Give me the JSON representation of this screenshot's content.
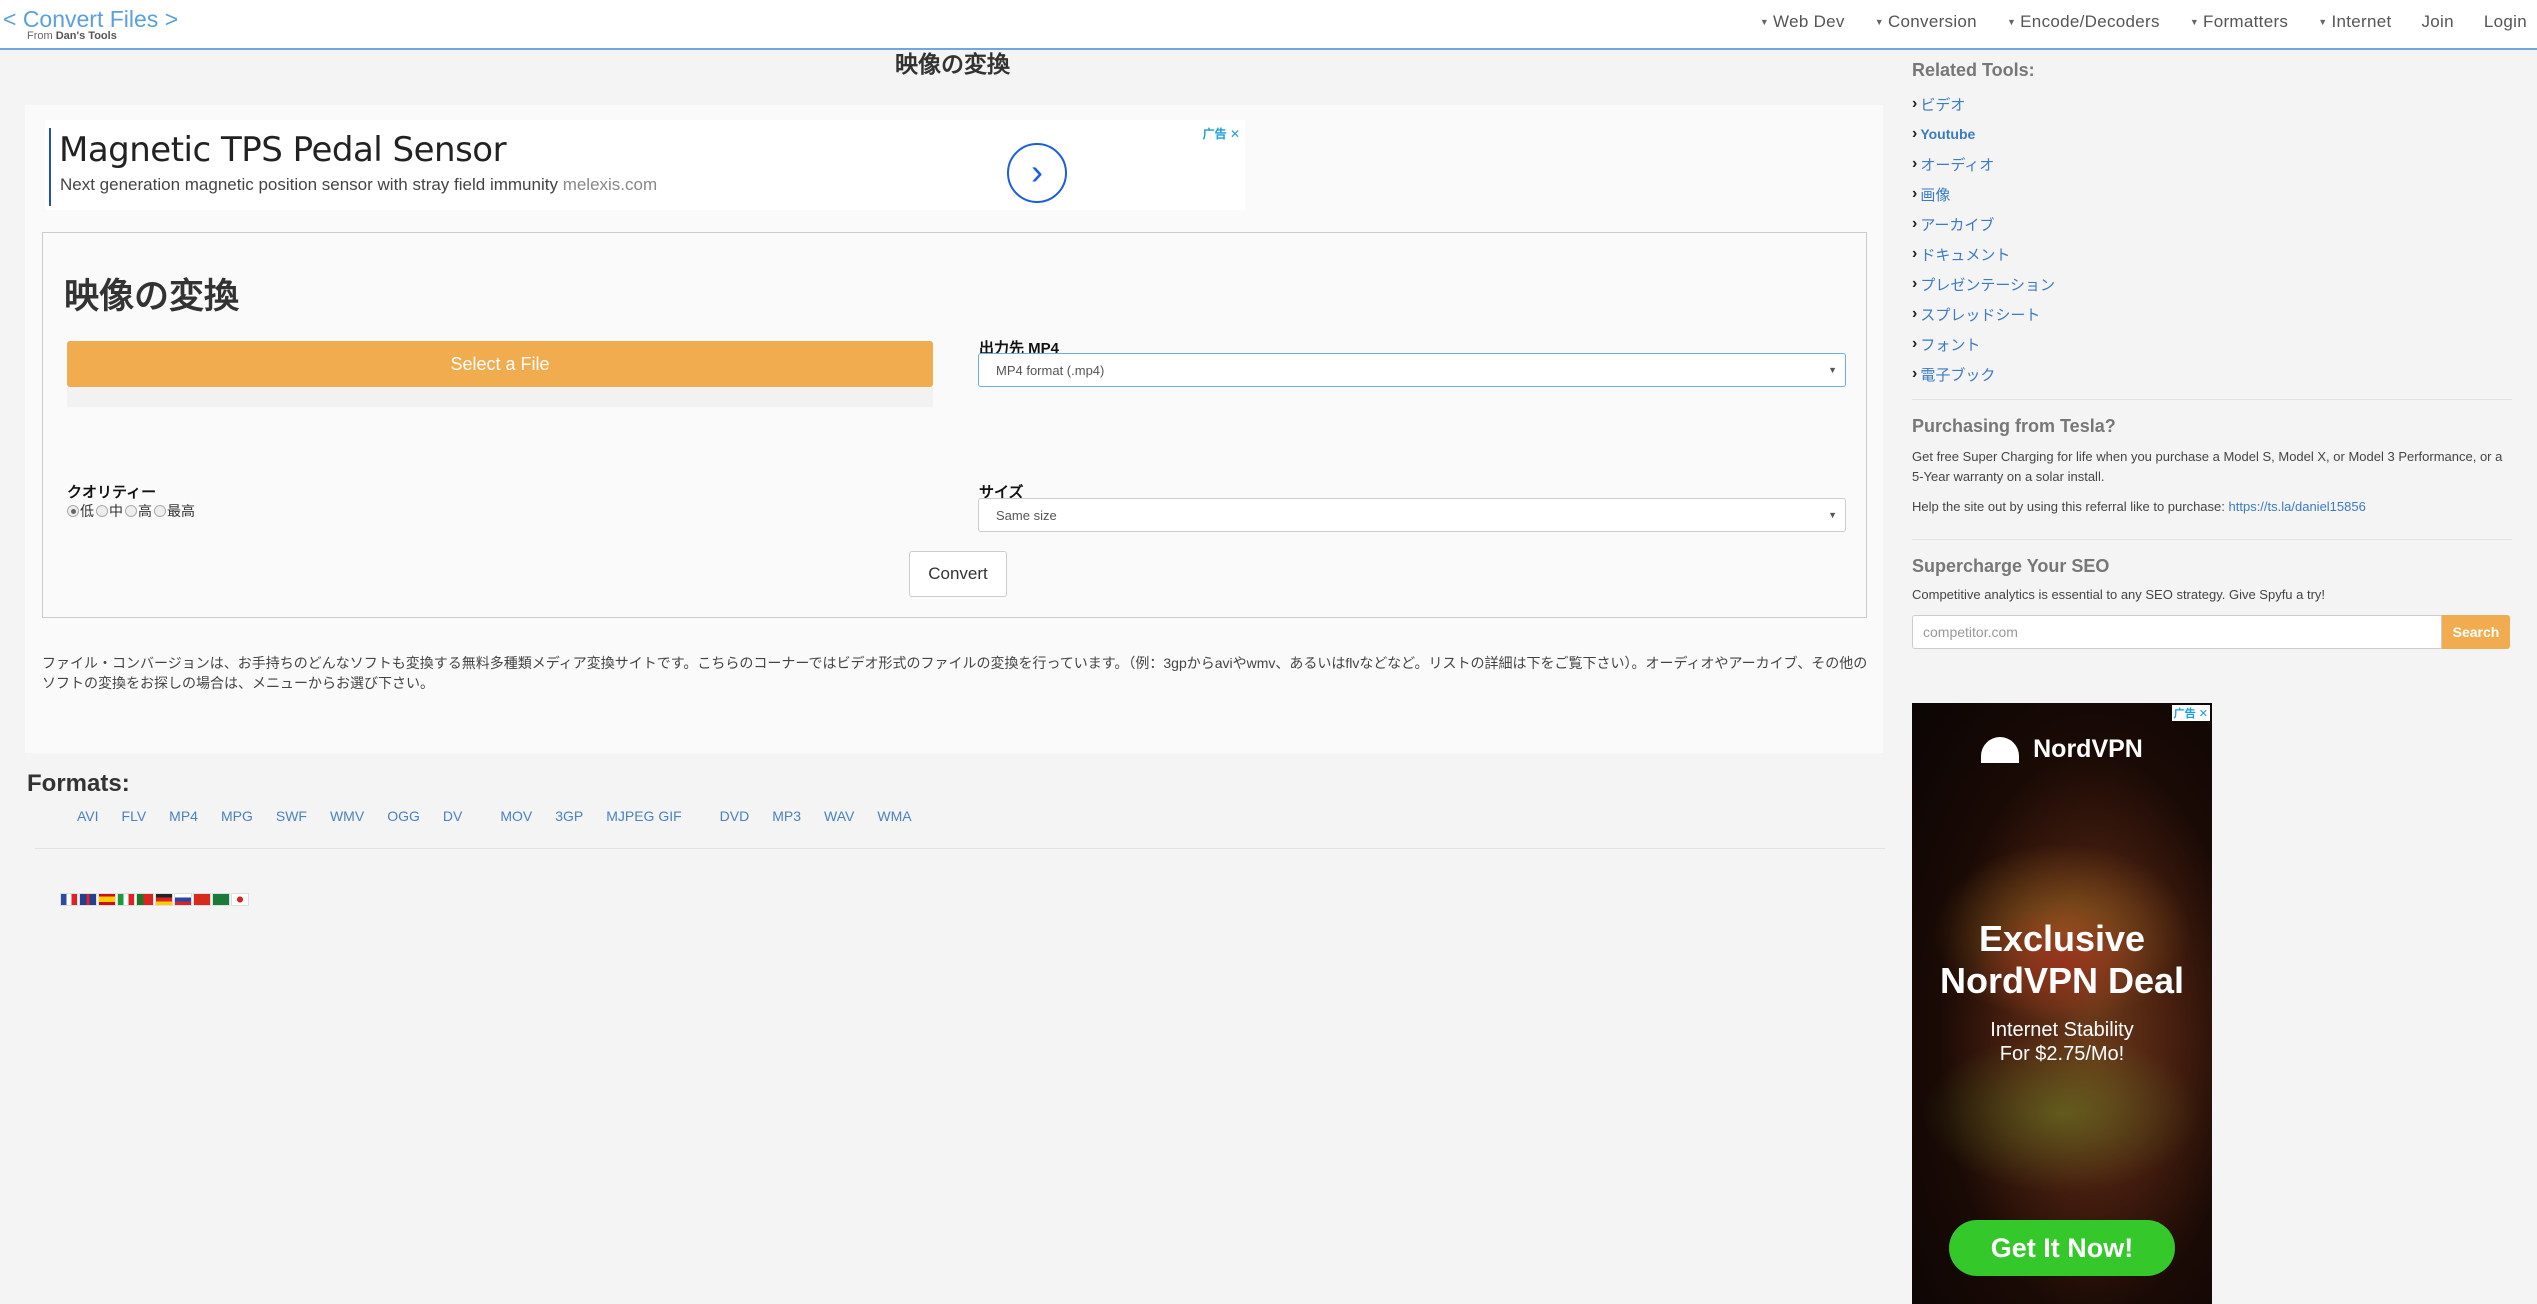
{
  "header": {
    "brand_title": "< Convert Files >",
    "brand_from": "From",
    "brand_owner": "Dan's Tools",
    "nav": [
      {
        "label": "Web Dev",
        "dropdown": true
      },
      {
        "label": "Conversion",
        "dropdown": true
      },
      {
        "label": "Encode/Decoders",
        "dropdown": true
      },
      {
        "label": "Formatters",
        "dropdown": true
      },
      {
        "label": "Internet",
        "dropdown": true
      },
      {
        "label": "Join",
        "dropdown": false
      },
      {
        "label": "Login",
        "dropdown": false
      }
    ]
  },
  "page_title": "映像の変換",
  "top_ad": {
    "headline": "Magnetic TPS Pedal Sensor",
    "description": "Next generation magnetic position sensor with stray field immunity",
    "domain": "melexis.com",
    "badge": "广告 ✕"
  },
  "form": {
    "title": "映像の変換",
    "select_file_label": "Select a File",
    "output_label": "出力先 MP4",
    "output_value": "MP4 format (.mp4)",
    "quality_label": "クオリティー",
    "quality_options": [
      {
        "label": "低",
        "checked": true
      },
      {
        "label": "中",
        "checked": false
      },
      {
        "label": "高",
        "checked": false
      },
      {
        "label": "最高",
        "checked": false
      }
    ],
    "size_label": "サイズ",
    "size_value": "Same size",
    "convert_label": "Convert"
  },
  "description": "ファイル・コンバージョンは、お手持ちのどんなソフトも変換する無料多種類メディア変換サイトです。こちらのコーナーではビデオ形式のファイルの変換を行っています。（例：3gpからaviやwmv、あるいはflvなどなど。リストの詳細は下をご覧下さい）。オーディオやアーカイブ、その他のソフトの変換をお探しの場合は、メニューからお選び下さい。",
  "formats": {
    "title": "Formats:",
    "items": [
      "AVI",
      "FLV",
      "MP4",
      "MPG",
      "SWF",
      "WMV",
      "OGG",
      "DV",
      "MOV",
      "3GP",
      "MJPEG GIF",
      "DVD",
      "MP3",
      "WAV",
      "WMA"
    ]
  },
  "language_flags": [
    "fr",
    "gb",
    "es",
    "it",
    "pt",
    "de",
    "ru",
    "cn",
    "sa",
    "jp"
  ],
  "sidebar": {
    "related_title": "Related Tools:",
    "related": [
      "ビデオ",
      "Youtube",
      "オーディオ",
      "画像",
      "アーカイブ",
      "ドキュメント",
      "プレゼンテーション",
      "スプレッドシート",
      "フォント",
      "電子ブック"
    ],
    "tesla_title": "Purchasing from Tesla?",
    "tesla_text": "Get free Super Charging for life when you purchase a Model S, Model X, or Model 3 Performance, or a 5-Year warranty on a solar install.",
    "tesla_help": "Help the site out by using this referral like to purchase:",
    "tesla_link": "https://ts.la/daniel15856",
    "seo_title": "Supercharge Your SEO",
    "seo_text": "Competitive analytics is essential to any SEO strategy. Give Spyfu a try!",
    "seo_placeholder": "competitor.com",
    "seo_button": "Search"
  },
  "side_ad": {
    "badge": "广告 ✕",
    "brand": "NordVPN",
    "headline_1": "Exclusive",
    "headline_2": "NordVPN Deal",
    "sub_1": "Internet Stability",
    "sub_2": "For $2.75/Mo!",
    "cta": "Get It Now!"
  },
  "colors": {
    "accent_orange": "#f0ac4e",
    "link_blue": "#3a7cc4",
    "header_border": "#6aa8e0",
    "cta_green": "#35c82a"
  }
}
